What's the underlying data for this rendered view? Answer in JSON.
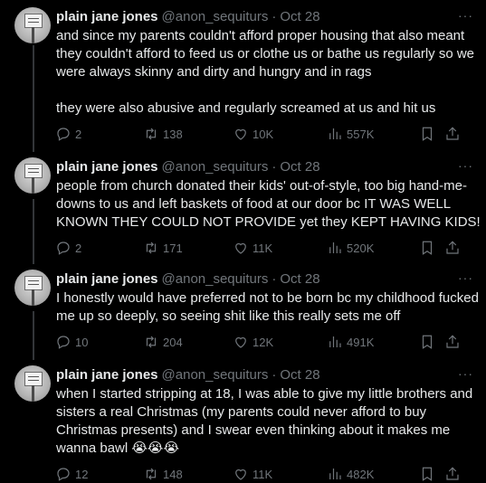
{
  "tweets": [
    {
      "name": "plain jane jones",
      "handle": "@anon_sequiturs",
      "separator": "·",
      "date": "Oct 28",
      "text": "and since my parents couldn't afford proper housing that also meant they couldn't afford to feed us or clothe us or bathe us regularly so we were always skinny and dirty and hungry and in rags\n\nthey were also abusive and regularly screamed at us and hit us",
      "replies": "2",
      "reposts": "138",
      "likes": "10K",
      "views": "557K"
    },
    {
      "name": "plain jane jones",
      "handle": "@anon_sequiturs",
      "separator": "·",
      "date": "Oct 28",
      "text": "people from church donated their kids' out-of-style, too big hand-me-downs to us and left baskets of food at our door bc IT WAS WELL KNOWN THEY COULD NOT PROVIDE yet they KEPT HAVING KIDS!",
      "replies": "2",
      "reposts": "171",
      "likes": "11K",
      "views": "520K"
    },
    {
      "name": "plain jane jones",
      "handle": "@anon_sequiturs",
      "separator": "·",
      "date": "Oct 28",
      "text": "I honestly would have preferred not to be born bc my childhood fucked me up so deeply, so seeing shit like this really sets me off",
      "replies": "10",
      "reposts": "204",
      "likes": "12K",
      "views": "491K"
    },
    {
      "name": "plain jane jones",
      "handle": "@anon_sequiturs",
      "separator": "·",
      "date": "Oct 28",
      "text": "when I started stripping at 18, I was able to give my little brothers and sisters a real Christmas (my parents could never afford to buy Christmas presents) and I swear even thinking about it makes me wanna bawl 😭😭😭",
      "replies": "12",
      "reposts": "148",
      "likes": "11K",
      "views": "482K"
    }
  ],
  "more_label": "···",
  "icons": [
    "reply-icon",
    "repost-icon",
    "like-icon",
    "views-icon",
    "bookmark-icon",
    "share-icon",
    "more-icon"
  ]
}
